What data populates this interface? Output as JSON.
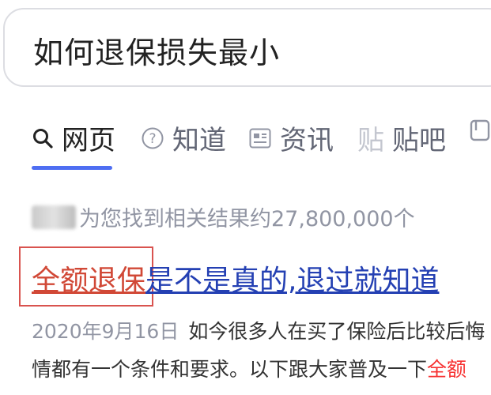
{
  "search": {
    "query": "如何退保损失最小"
  },
  "tabs": [
    {
      "label": "网页",
      "icon": "search-icon",
      "active": true
    },
    {
      "label": "知道",
      "icon": "question-circle-icon",
      "active": false
    },
    {
      "label": "资讯",
      "icon": "news-icon",
      "active": false
    },
    {
      "label": "贴吧",
      "icon": "tieba-icon",
      "active": false
    },
    {
      "label": "",
      "icon": "video-icon",
      "active": false
    }
  ],
  "results": {
    "count_text": "为您找到相关结果约27,800,000个",
    "first": {
      "title_highlight": "全额退保",
      "title_rest": "是不是真的,退过就知道",
      "date": "2020年9月16日",
      "snippet_line1": "如今很多人在买了保险后比较后悔",
      "snippet_line2_prefix": "情都有一个条件和要求。以下跟大家普及一下",
      "snippet_line2_highlight": "全额"
    }
  },
  "colors": {
    "accent": "#4e6ef2",
    "link": "#2440b3",
    "highlight_red": "#d14836",
    "highlight_box": "#d9534f"
  }
}
